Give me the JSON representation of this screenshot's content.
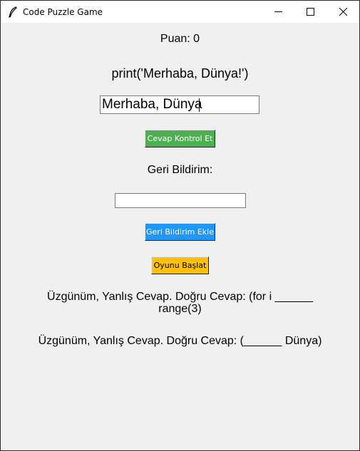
{
  "window": {
    "title": "Code Puzzle Game",
    "icon": "feather-icon"
  },
  "game": {
    "score_text": "Puan: 0",
    "code_text": "print('Merhaba, Dünya!')",
    "answer_value": "Merhaba, Dünya",
    "check_button": "Cevap Kontrol Et",
    "feedback_label": "Geri Bildirim:",
    "feedback_value": "",
    "feedback_button": "Geri Bildirim Ekle",
    "start_button": "Oyunu Başlat",
    "result_line1_a": "Üzgünüm, Yanlış Cevap. Doğru Cevap: (for i ______",
    "result_line1_b": "range(3)",
    "result_line2": "Üzgünüm, Yanlış Cevap. Doğru Cevap: (______ Dünya)"
  },
  "colors": {
    "check_button": "#4caf50",
    "feedback_button": "#2196f3",
    "start_button": "#ffc107",
    "background": "#f0f0f0"
  }
}
